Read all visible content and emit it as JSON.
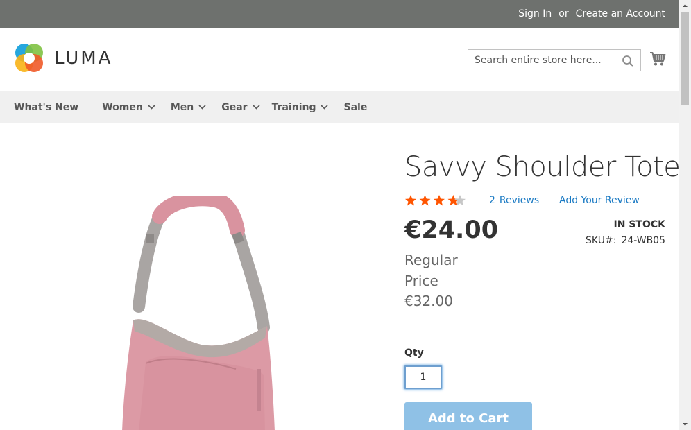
{
  "top_bar": {
    "sign_in": "Sign In",
    "or": "or",
    "create_account": "Create an Account"
  },
  "header": {
    "logo_text": "LUMA",
    "search_placeholder": "Search entire store here...",
    "icons": {
      "search": "search-icon",
      "cart": "cart-icon"
    }
  },
  "nav": {
    "items": [
      {
        "label": "What's New",
        "has_dropdown": false
      },
      {
        "label": "Women",
        "has_dropdown": true
      },
      {
        "label": "Men",
        "has_dropdown": true
      },
      {
        "label": "Gear",
        "has_dropdown": true
      },
      {
        "label": "Training",
        "has_dropdown": true
      },
      {
        "label": "Sale",
        "has_dropdown": false
      }
    ]
  },
  "product": {
    "title": "Savvy Shoulder Tote",
    "rating": {
      "stars_filled": 4,
      "stars_total": 5
    },
    "reviews_count": "2",
    "reviews_label": "Reviews",
    "add_review": "Add Your Review",
    "price": "€24.00",
    "regular_price_label": "Regular Price",
    "regular_price": "€32.00",
    "stock_status": "IN STOCK",
    "sku_label": "SKU#:",
    "sku": "24-WB05",
    "qty_label": "Qty",
    "qty_value": "1",
    "add_to_cart": "Add to Cart"
  },
  "colors": {
    "top_bar": "#6e716e",
    "nav_bg": "#f0f0f0",
    "link": "#1979c3",
    "star": "#ff5501",
    "add_to_cart": "#8fc1e6"
  }
}
